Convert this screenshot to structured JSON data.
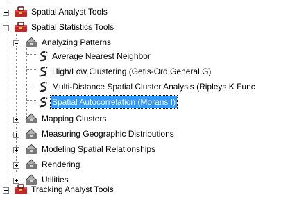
{
  "tree": {
    "items": [
      {
        "label": "Spatial Analyst Tools",
        "icon": "red-toolbox-icon",
        "expanded": false
      },
      {
        "label": "Spatial Statistics Tools",
        "icon": "red-toolbox-icon",
        "expanded": true
      },
      {
        "label": "Analyzing Patterns",
        "icon": "toolset-icon",
        "expanded": true
      },
      {
        "label": "Average Nearest Neighbor",
        "icon": "script-tool-icon"
      },
      {
        "label": "High/Low Clustering (Getis-Ord General G)",
        "icon": "script-tool-icon"
      },
      {
        "label": "Multi-Distance Spatial Cluster Analysis (Ripleys K Func",
        "icon": "script-tool-icon"
      },
      {
        "label": "Spatial Autocorrelation (Morans I)",
        "icon": "script-tool-icon",
        "selected": true
      },
      {
        "label": "Mapping Clusters",
        "icon": "toolset-icon",
        "expanded": false
      },
      {
        "label": "Measuring Geographic Distributions",
        "icon": "toolset-icon",
        "expanded": false
      },
      {
        "label": "Modeling Spatial Relationships",
        "icon": "toolset-icon",
        "expanded": false
      },
      {
        "label": "Rendering",
        "icon": "toolset-icon",
        "expanded": false
      },
      {
        "label": "Utilities",
        "icon": "toolset-icon",
        "expanded": false
      },
      {
        "label": "Tracking Analyst Tools",
        "icon": "red-toolbox-icon",
        "expanded": false
      }
    ]
  },
  "colors": {
    "selection": "#3399ff",
    "toolbox_red": "#c0282d",
    "toolset_gray": "#7a7a7a"
  }
}
